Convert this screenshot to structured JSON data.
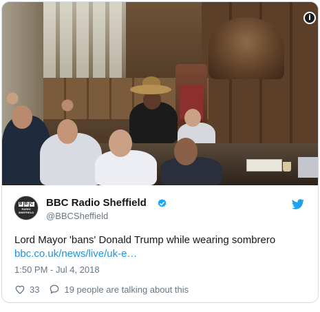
{
  "tweet": {
    "author_name": "BBC Radio Sheffield",
    "author_handle": "@BBCSheffield",
    "avatar_blocks": [
      "B",
      "B",
      "C"
    ],
    "avatar_caption_line1": "RADIO",
    "avatar_caption_line2": "SHEFFIELD",
    "verified": true,
    "text": "Lord Mayor 'bans' Donald Trump while wearing sombrero",
    "link_text": "bbc.co.uk/news/live/uk-e…",
    "timestamp": "1:50 PM - Jul 4, 2018",
    "likes": "33",
    "conversation": "19 people are talking about this"
  },
  "icons": {
    "info": "info-icon",
    "verified": "verified-badge-icon",
    "brand": "twitter-bird-icon",
    "like": "heart-icon",
    "reply": "speech-bubble-icon"
  },
  "colors": {
    "link": "#1b95e0",
    "verified": "#1da1f2",
    "brand": "#1da1f2",
    "muted": "#657786",
    "text": "#14171a"
  }
}
